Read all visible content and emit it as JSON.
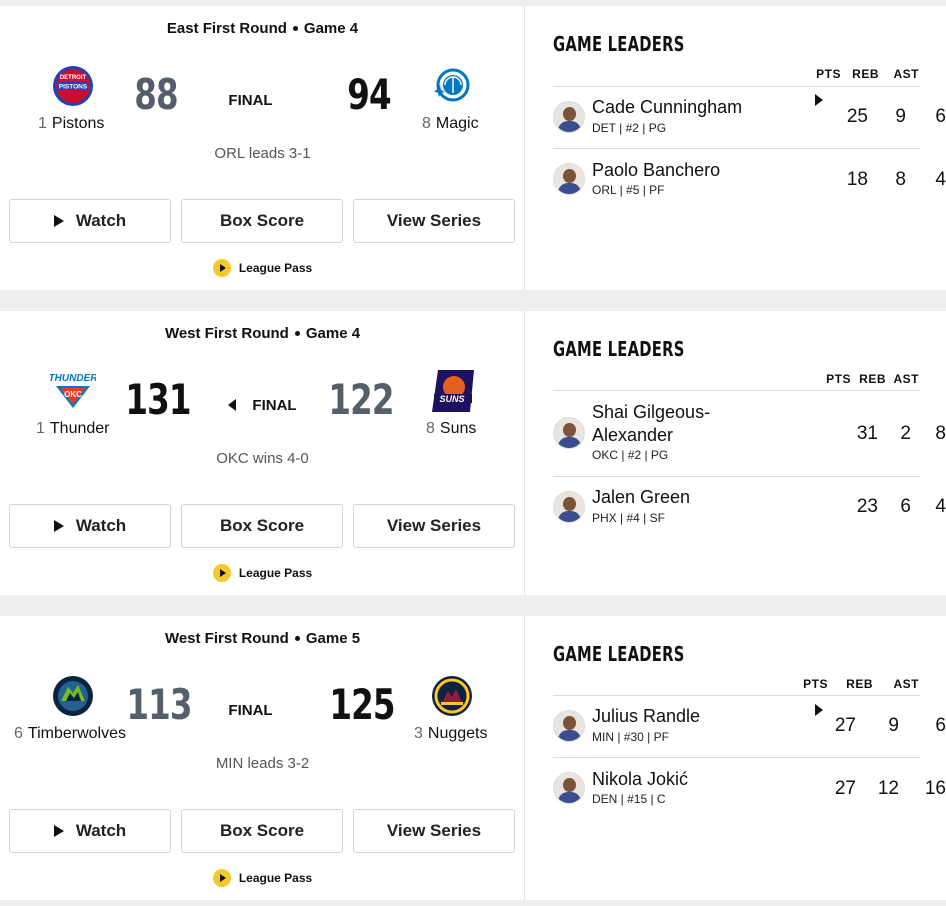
{
  "games": [
    {
      "round": "East First Round",
      "game": "Game 4",
      "status": "FINAL",
      "arrow": "right",
      "away": {
        "seed": "1",
        "name": "Pistons",
        "score": "88",
        "result": "lose",
        "color": "#c8102e",
        "logo": "pistons-logo-icon"
      },
      "home": {
        "seed": "8",
        "name": "Magic",
        "score": "94",
        "result": "win",
        "color": "#0077c0",
        "logo": "magic-logo-icon"
      },
      "series": "ORL leads 3-1",
      "buttons": {
        "watch": "Watch",
        "box": "Box Score",
        "view": "View Series"
      },
      "league_pass": "League Pass",
      "leaders_title": "GAME LEADERS",
      "headers": {
        "pts": "PTS",
        "reb": "REB",
        "ast": "AST"
      },
      "leaders": [
        {
          "name": "Cade Cunningham",
          "meta": "DET | #2 | PG",
          "pts": "25",
          "reb": "9",
          "ast": "6"
        },
        {
          "name": "Paolo Banchero",
          "meta": "ORL | #5 | PF",
          "pts": "18",
          "reb": "8",
          "ast": "4"
        }
      ]
    },
    {
      "round": "West First Round",
      "game": "Game 4",
      "status": "FINAL",
      "arrow": "left",
      "away": {
        "seed": "1",
        "name": "Thunder",
        "score": "131",
        "result": "win",
        "color": "#007ac1",
        "logo": "thunder-logo-icon"
      },
      "home": {
        "seed": "8",
        "name": "Suns",
        "score": "122",
        "result": "lose",
        "color": "#e56020",
        "logo": "suns-logo-icon"
      },
      "series": "OKC wins 4-0",
      "buttons": {
        "watch": "Watch",
        "box": "Box Score",
        "view": "View Series"
      },
      "league_pass": "League Pass",
      "leaders_title": "GAME LEADERS",
      "headers": {
        "pts": "PTS",
        "reb": "REB",
        "ast": "AST"
      },
      "leaders": [
        {
          "name": "Shai Gilgeous-",
          "name2": "Alexander",
          "meta": "OKC | #2 | PG",
          "pts": "31",
          "reb": "2",
          "ast": "8"
        },
        {
          "name": "Jalen Green",
          "meta": "PHX | #4 | SF",
          "pts": "23",
          "reb": "6",
          "ast": "4"
        }
      ]
    },
    {
      "round": "West First Round",
      "game": "Game 5",
      "status": "FINAL",
      "arrow": "right",
      "away": {
        "seed": "6",
        "name": "Timberwolves",
        "score": "113",
        "result": "lose",
        "color": "#236192",
        "logo": "timberwolves-logo-icon"
      },
      "home": {
        "seed": "3",
        "name": "Nuggets",
        "score": "125",
        "result": "win",
        "color": "#0e2240",
        "logo": "nuggets-logo-icon"
      },
      "series": "MIN leads 3-2",
      "buttons": {
        "watch": "Watch",
        "box": "Box Score",
        "view": "View Series"
      },
      "league_pass": "League Pass",
      "leaders_title": "GAME LEADERS",
      "headers": {
        "pts": "PTS",
        "reb": "REB",
        "ast": "AST"
      },
      "leaders": [
        {
          "name": "Julius Randle",
          "meta": "MIN | #30 | PF",
          "pts": "27",
          "reb": "9",
          "ast": "6"
        },
        {
          "name": "Nikola Jokić",
          "meta": "DEN | #15 | C",
          "pts": "27",
          "reb": "12",
          "ast": "16"
        }
      ]
    }
  ]
}
